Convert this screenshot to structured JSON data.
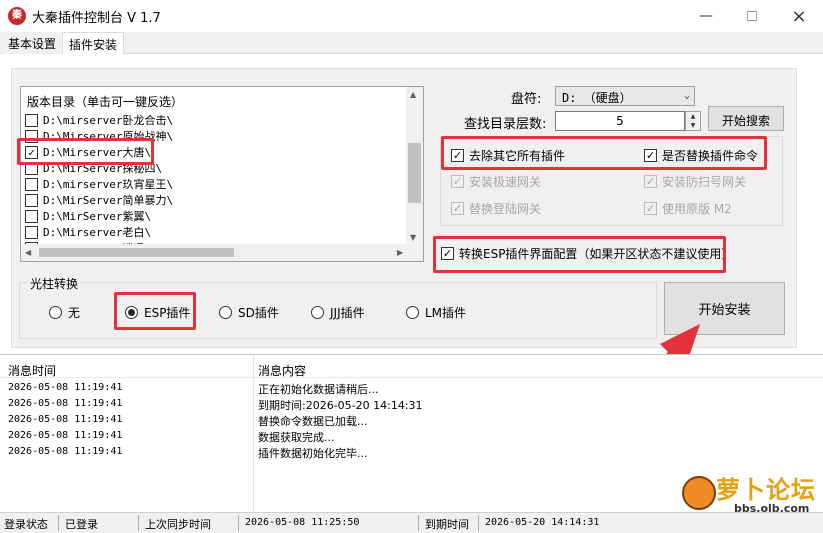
{
  "window": {
    "title": "大秦插件控制台 V 1.7",
    "icon_text": "秦",
    "minimize_icon": "minimize-icon",
    "maximize_icon": "maximize-icon",
    "close_icon": "close-icon"
  },
  "tabs": [
    {
      "label": "基本设置",
      "active": false
    },
    {
      "label": "插件安装",
      "active": true
    }
  ],
  "dir_list": {
    "header": "版本目录（单击可一键反选）",
    "items": [
      {
        "path": "D:\\mirserver卧龙合击\\",
        "checked": false
      },
      {
        "path": "D:\\Mirserver原始战神\\",
        "checked": false
      },
      {
        "path": "D:\\Mirserver大唐\\",
        "checked": true
      },
      {
        "path": "D:\\MirServer探秘四\\",
        "checked": false
      },
      {
        "path": "D:\\mirserver玖宵星王\\",
        "checked": false
      },
      {
        "path": "D:\\MirServer简单暴力\\",
        "checked": false
      },
      {
        "path": "D:\\MirServer紫翼\\",
        "checked": false
      },
      {
        "path": "D:\\Mirserver老白\\",
        "checked": false
      },
      {
        "path": "D:\\MirServer逍遥\\",
        "checked": false
      }
    ]
  },
  "drive": {
    "label": "盘符:",
    "value": "D: （硬盘）"
  },
  "depth": {
    "label": "查找目录层数:",
    "value": "5"
  },
  "search_button": "开始搜索",
  "options": {
    "remove_others": {
      "label": "去除其它所有插件",
      "checked": true
    },
    "replace_cmd": {
      "label": "是否替换插件命令",
      "checked": true
    },
    "install_speed_gw": {
      "label": "安装极速网关",
      "checked": true
    },
    "install_antiscan_gw": {
      "label": "安装防扫号网关",
      "checked": true
    },
    "replace_login_gw": {
      "label": "替换登陆网关",
      "checked": true
    },
    "use_original_m2": {
      "label": "使用原版 M2",
      "checked": true
    }
  },
  "esp_config": {
    "label": "转换ESP插件界面配置（如果开区状态不建议使用）",
    "checked": true
  },
  "light": {
    "title": "光柱转换",
    "options": [
      {
        "label": "无",
        "selected": false
      },
      {
        "label": "ESP插件",
        "selected": true
      },
      {
        "label": "SD插件",
        "selected": false
      },
      {
        "label": "JJJ插件",
        "selected": false
      },
      {
        "label": "LM插件",
        "selected": false
      }
    ]
  },
  "install_button": "开始安装",
  "log": {
    "col_time": "消息时间",
    "col_msg": "消息内容",
    "rows": [
      {
        "time": "2026-05-08 11:19:41",
        "msg": "正在初始化数据请稍后..."
      },
      {
        "time": "2026-05-08 11:19:41",
        "msg": "到期时间:2026-05-20 14:14:31"
      },
      {
        "time": "2026-05-08 11:19:41",
        "msg": "替换命令数据已加载..."
      },
      {
        "time": "2026-05-08 11:19:41",
        "msg": "数据获取完成..."
      },
      {
        "time": "2026-05-08 11:19:41",
        "msg": "插件数据初始化完毕..."
      }
    ]
  },
  "status": {
    "login_label": "登录状态",
    "login_value": "已登录",
    "sync_label": "上次同步时间",
    "sync_value": "2026-05-08 11:25:50",
    "expire_label": "到期时间",
    "expire_value": "2026-05-20 14:14:31"
  },
  "watermark": {
    "text": "萝卜论坛",
    "url": "bbs.olb.com"
  },
  "colors": {
    "highlight": "#e2333a",
    "arrow": "#e2333a"
  }
}
